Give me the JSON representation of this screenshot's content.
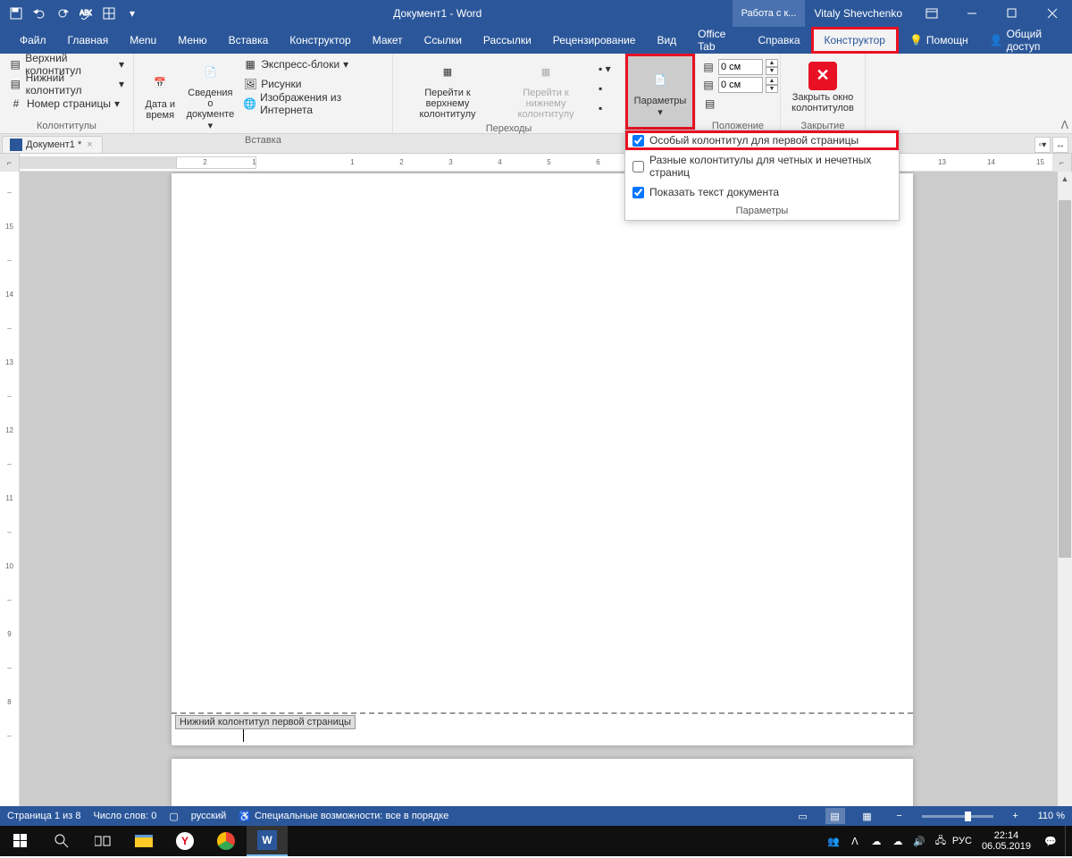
{
  "titlebar": {
    "title": "Документ1 - Word",
    "context_tab": "Работа с к...",
    "username": "Vitaly Shevchenko"
  },
  "menus": {
    "file": "Файл",
    "home": "Главная",
    "menu1": "Menu",
    "menu2": "Меню",
    "insert": "Вставка",
    "constructor1": "Конструктор",
    "layout": "Макет",
    "refs": "Ссылки",
    "mailings": "Рассылки",
    "review": "Рецензирование",
    "view": "Вид",
    "officetab": "Office Tab",
    "help": "Справка",
    "constructor2": "Конструктор",
    "assist": "Помощн",
    "share": "Общий доступ"
  },
  "ribbon": {
    "header_top": "Верхний колонтитул",
    "header_bottom": "Нижний колонтитул",
    "page_number": "Номер страницы",
    "group_headers": "Колонтитулы",
    "date_time": "Дата и время",
    "doc_info": "Сведения о документе",
    "quick_parts": "Экспресс-блоки",
    "pictures": "Рисунки",
    "online_pictures": "Изображения из Интернета",
    "group_insert": "Вставка",
    "goto_header": "Перейти к верхнему колонтитулу",
    "goto_footer": "Перейти к нижнему колонтитулу",
    "group_nav": "Переходы",
    "options": "Параметры",
    "top_margin": "0 см",
    "bottom_margin": "0 см",
    "group_position": "Положение",
    "close_header": "Закрыть окно колонтитулов",
    "group_close": "Закрытие"
  },
  "dropdown": {
    "opt1": "Особый колонтитул для первой страницы",
    "opt2": "Разные колонтитулы для четных и нечетных страниц",
    "opt3": "Показать текст документа",
    "footer": "Параметры"
  },
  "doctab": {
    "name": "Документ1 *"
  },
  "page": {
    "footer_tag": "Нижний колонтитул первой страницы"
  },
  "statusbar": {
    "page": "Страница 1 из 8",
    "words": "Число слов: 0",
    "lang": "русский",
    "a11y": "Специальные возможности: все в порядке",
    "zoom": "110 %"
  },
  "taskbar": {
    "lang": "РУС",
    "time": "22:14",
    "date": "06.05.2019"
  }
}
